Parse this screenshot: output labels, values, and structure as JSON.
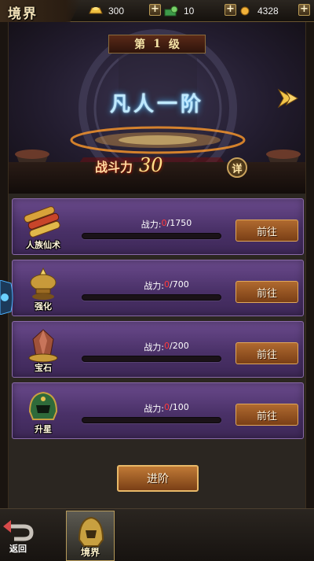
{
  "header": {
    "title": "境界",
    "resources": [
      {
        "icon": "gold-ingot-icon",
        "value": "300"
      },
      {
        "icon": "jade-coin-icon",
        "value": "10"
      },
      {
        "icon": "copper-coin-icon",
        "value": "4328"
      }
    ],
    "plus_label": "+"
  },
  "banner": {
    "level_prefix": "第",
    "level_number": "1",
    "level_suffix": "级",
    "realm_name": "凡人一阶",
    "power_label": "战斗力",
    "power_value": "30",
    "detail_label": "详"
  },
  "tasks": [
    {
      "name": "人族仙术",
      "icon": "scroll-bundle-icon",
      "label": "战力:",
      "current": "0",
      "target": "/1750",
      "progress": 0,
      "button": "前往"
    },
    {
      "name": "强化",
      "icon": "lamp-icon",
      "label": "战力:",
      "current": "0",
      "target": "/700",
      "progress": 0,
      "button": "前往"
    },
    {
      "name": "宝石",
      "icon": "gem-icon",
      "label": "战力:",
      "current": "0",
      "target": "/200",
      "progress": 0,
      "button": "前往"
    },
    {
      "name": "升星",
      "icon": "helmet-icon",
      "label": "战力:",
      "current": "0",
      "target": "/100",
      "progress": 0,
      "button": "前往"
    }
  ],
  "advance_button": "进阶",
  "footer": {
    "back_label": "返回",
    "tab_label": "境界"
  },
  "colors": {
    "accent_gold": "#e0a85a",
    "task_purple": "#4a3168",
    "warning_red": "#ff3b3b"
  }
}
